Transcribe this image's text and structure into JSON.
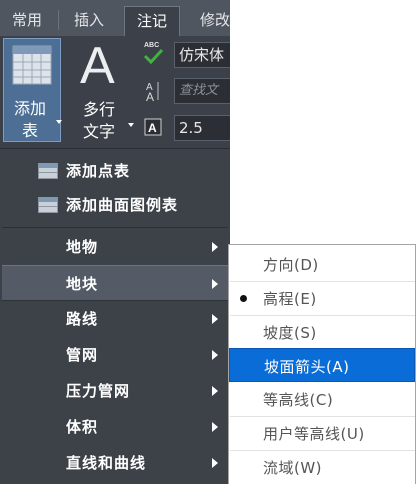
{
  "ribbon": {
    "tabs": [
      "常用",
      "插入",
      "注记",
      "修改"
    ],
    "active_tab_index": 2,
    "add_table": {
      "line1": "添加",
      "line2": "表"
    },
    "multiline_text": {
      "glyph": "A",
      "line1": "多行",
      "line2": "文字"
    },
    "style_field": "仿宋体",
    "find_placeholder": "查找文",
    "height_field": "2.5",
    "abc_text": "ABC"
  },
  "menu": {
    "items": [
      {
        "label": "添加点表",
        "icon": "table-icon",
        "submenu": false
      },
      {
        "label": "添加曲面图例表",
        "icon": "table-icon",
        "submenu": false
      },
      {
        "label": "地物",
        "submenu": true
      },
      {
        "label": "地块",
        "submenu": true,
        "highlighted": true
      },
      {
        "label": "路线",
        "submenu": true
      },
      {
        "label": "管网",
        "submenu": true
      },
      {
        "label": "压力管网",
        "submenu": true
      },
      {
        "label": "体积",
        "submenu": true
      },
      {
        "label": "直线和曲线",
        "submenu": true
      }
    ]
  },
  "submenu": {
    "items": [
      {
        "label": "方向(D)"
      },
      {
        "label": "高程(E)",
        "checked": true
      },
      {
        "label": "坡度(S)"
      },
      {
        "label": "坡面箭头(A)",
        "selected": true
      },
      {
        "label": "等高线(C)"
      },
      {
        "label": "用户等高线(U)"
      },
      {
        "label": "流域(W)"
      }
    ]
  },
  "colors": {
    "ribbon_bg": "#3b4049",
    "menu_bg": "#3d4249",
    "selection": "#0a6cd6",
    "add_button": "#4e6f95"
  }
}
